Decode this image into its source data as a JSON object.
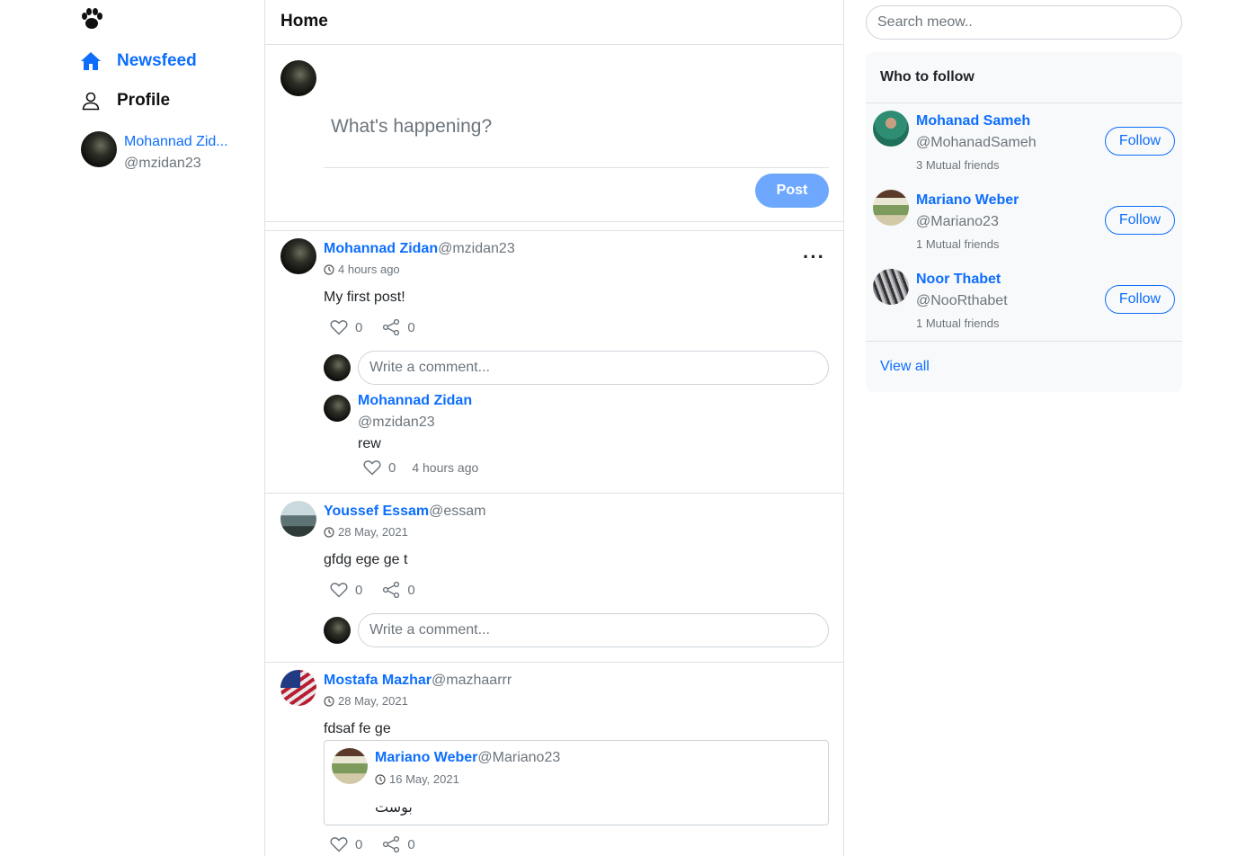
{
  "nav": {
    "newsfeed_label": "Newsfeed",
    "profile_label": "Profile",
    "me_name": "Mohannad Zid...",
    "me_handle": "@mzidan23"
  },
  "feed": {
    "title": "Home",
    "composer_placeholder": "What's happening?",
    "post_label": "Post",
    "comment_placeholder": "Write a comment...",
    "posts": [
      {
        "author": "Mohannad Zidan",
        "handle": "@mzidan23",
        "time": "4 hours ago",
        "text": "My first post!",
        "likes": "0",
        "shares": "0",
        "comments": [
          {
            "author": "Mohannad Zidan",
            "handle": "@mzidan23",
            "text": "rew",
            "likes": "0",
            "time": "4 hours ago"
          }
        ]
      },
      {
        "author": "Youssef Essam",
        "handle": "@essam",
        "time": "28 May, 2021",
        "text": "gfdg ege ge t",
        "likes": "0",
        "shares": "0"
      },
      {
        "author": "Mostafa Mazhar",
        "handle": "@mazhaarrr",
        "time": "28 May, 2021",
        "text": "fdsaf fe ge",
        "likes": "0",
        "shares": "0",
        "quoted": {
          "author": "Mariano Weber",
          "handle": "@Mariano23",
          "time": "16 May, 2021",
          "text": "بوست"
        }
      }
    ]
  },
  "right": {
    "search_placeholder": "Search meow..",
    "who_to_follow_title": "Who to follow",
    "follow_label": "Follow",
    "view_all_label": "View all",
    "suggestions": [
      {
        "name": "Mohanad Sameh",
        "handle": "@MohanadSameh",
        "mutual": "3 Mutual friends"
      },
      {
        "name": "Mariano Weber",
        "handle": "@Mariano23",
        "mutual": "1 Mutual friends"
      },
      {
        "name": "Noor Thabet",
        "handle": "@NooRthabet",
        "mutual": "1 Mutual friends"
      }
    ]
  },
  "colors": {
    "primary": "#0d6efd",
    "post_button": "#6ea8fe",
    "muted": "#6c757d",
    "border": "#dee2e6"
  },
  "icons": [
    "paw-icon",
    "home-icon",
    "user-icon",
    "clock-icon",
    "heart-icon",
    "share-icon",
    "more-icon"
  ]
}
